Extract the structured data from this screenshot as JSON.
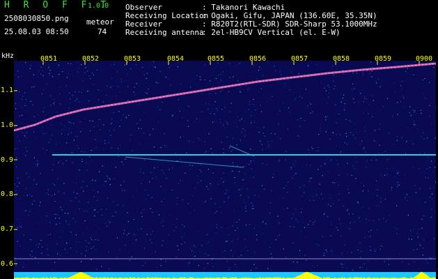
{
  "header": {
    "app_name": "H R O F F T",
    "app_version": "1.0.0",
    "file_name": "2508030850.png",
    "datetime": "25.08.03 08:50",
    "meteor_label": "meteor",
    "meteor_count": "74"
  },
  "info": {
    "observer_label": "Observer",
    "observer_value": ": Takanori Kawachi",
    "location_label": "Receiving Location",
    "location_value": ": Ogaki, Gifu, JAPAN (136.60E, 35.35N)",
    "receiver_label": "Receiver",
    "receiver_value": ": R820T2(RTL-SDR) SDR-Sharp 53.1000MHz",
    "antenna_label": "Receiving antenna",
    "antenna_value": ": 2el-HB9CV Vertical (el. E-W)"
  },
  "axes": {
    "y_unit": "kHz",
    "y_labels": [
      "1.1",
      "1.0",
      "0.9",
      "0.8",
      "0.7",
      "0.6"
    ],
    "x_labels": [
      "0851",
      "0852",
      "0853",
      "0854",
      "0855",
      "0856",
      "0857",
      "0858",
      "0859",
      "0900"
    ]
  },
  "colors": {
    "background": "#000000",
    "spectrum_bg": "#0a0a52",
    "label_yellow": "#ffff00",
    "title_green": "#35e835",
    "trace": "#ff66cc",
    "horizontal_line": "#33ccdd",
    "level_bar": "#ffff00",
    "level_base": "#1ec8ff"
  }
}
